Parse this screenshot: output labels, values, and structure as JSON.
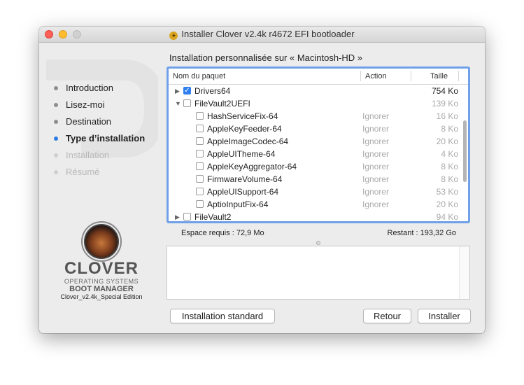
{
  "window": {
    "title": "Installer Clover v2.4k r4672 EFI bootloader",
    "title_icon": "installer-package-icon"
  },
  "sidebar": {
    "steps": [
      {
        "label": "Introduction",
        "state": "done"
      },
      {
        "label": "Lisez-moi",
        "state": "done"
      },
      {
        "label": "Destination",
        "state": "done"
      },
      {
        "label": "Type d’installation",
        "state": "active"
      },
      {
        "label": "Installation",
        "state": "disabled"
      },
      {
        "label": "Résumé",
        "state": "disabled"
      }
    ],
    "logo": {
      "word": "CLOVER",
      "line1": "OPERATING SYSTEMS",
      "line2": "BOOT MANAGER",
      "edition": "Clover_v2.4k_Special Edition"
    }
  },
  "main": {
    "heading": "Installation personnalisée sur « Macintosh-HD »",
    "table": {
      "columns": {
        "name": "Nom du paquet",
        "action": "Action",
        "size": "Taille"
      },
      "rows": [
        {
          "name": "Drivers64",
          "action": "",
          "size": "754 Ko",
          "checked": true,
          "disclosure": "collapsed",
          "level": 0
        },
        {
          "name": "FileVault2UEFI",
          "action": "",
          "size": "139 Ko",
          "checked": false,
          "disclosure": "expanded",
          "level": 0
        },
        {
          "name": "HashServiceFix-64",
          "action": "Ignorer",
          "size": "16 Ko",
          "checked": false,
          "disclosure": "none",
          "level": 1
        },
        {
          "name": "AppleKeyFeeder-64",
          "action": "Ignorer",
          "size": "8 Ko",
          "checked": false,
          "disclosure": "none",
          "level": 1
        },
        {
          "name": "AppleImageCodec-64",
          "action": "Ignorer",
          "size": "20 Ko",
          "checked": false,
          "disclosure": "none",
          "level": 1
        },
        {
          "name": "AppleUITheme-64",
          "action": "Ignorer",
          "size": "4 Ko",
          "checked": false,
          "disclosure": "none",
          "level": 1
        },
        {
          "name": "AppleKeyAggregator-64",
          "action": "Ignorer",
          "size": "8 Ko",
          "checked": false,
          "disclosure": "none",
          "level": 1
        },
        {
          "name": "FirmwareVolume-64",
          "action": "Ignorer",
          "size": "8 Ko",
          "checked": false,
          "disclosure": "none",
          "level": 1
        },
        {
          "name": "AppleUISupport-64",
          "action": "Ignorer",
          "size": "53 Ko",
          "checked": false,
          "disclosure": "none",
          "level": 1
        },
        {
          "name": "AptioInputFix-64",
          "action": "Ignorer",
          "size": "20 Ko",
          "checked": false,
          "disclosure": "none",
          "level": 1
        },
        {
          "name": "FileVault2",
          "action": "",
          "size": "94 Ko",
          "checked": false,
          "disclosure": "collapsed",
          "level": 0
        }
      ]
    },
    "space": {
      "required": "Espace requis :  72,9 Mo",
      "remaining": "Restant :  193,32 Go"
    }
  },
  "buttons": {
    "standard": "Installation standard",
    "back": "Retour",
    "install": "Installer"
  },
  "colors": {
    "accent": "#2f7ff0",
    "focus_ring": "#6fa0e8",
    "active_step_dot": "#2c7be5",
    "close": "#fe5f57",
    "minimize": "#febc2e"
  }
}
